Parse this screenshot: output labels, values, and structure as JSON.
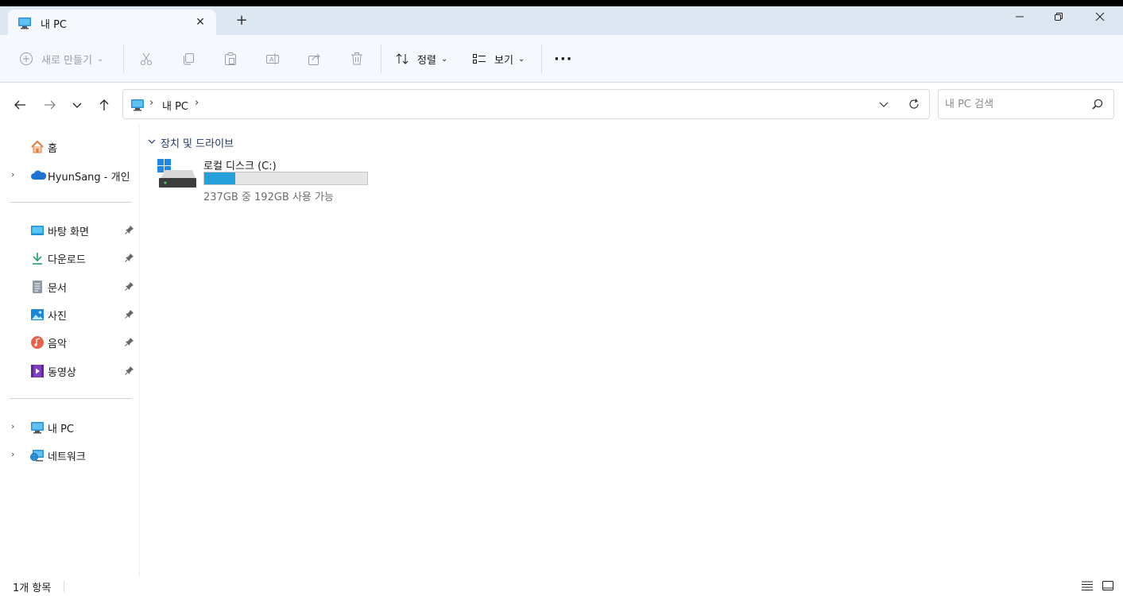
{
  "tab": {
    "title": "내 PC",
    "close_glyph": "✕",
    "new_tab_glyph": "+",
    "icon": "pc-icon"
  },
  "window_controls": {
    "minimize": "—",
    "maximize": "❐",
    "close": "✕"
  },
  "toolbar": {
    "new_label": "새로 만들기",
    "sort_label": "정렬",
    "view_label": "보기",
    "more_label": "···",
    "disabled_color": "#9aa0a6"
  },
  "address": {
    "segment": "내 PC",
    "separator": "›"
  },
  "search": {
    "placeholder": "내 PC 검색"
  },
  "sidebar": {
    "home": {
      "label": "홈",
      "icon": "home-icon"
    },
    "onedrive": {
      "label": "HyunSang - 개인",
      "icon": "cloud-icon"
    },
    "quick": [
      {
        "label": "바탕 화면",
        "icon": "desktop-icon"
      },
      {
        "label": "다운로드",
        "icon": "download-icon"
      },
      {
        "label": "문서",
        "icon": "document-icon"
      },
      {
        "label": "사진",
        "icon": "pictures-icon"
      },
      {
        "label": "음악",
        "icon": "music-icon"
      },
      {
        "label": "동영상",
        "icon": "video-icon"
      }
    ],
    "this_pc": {
      "label": "내 PC",
      "icon": "pc-icon"
    },
    "network": {
      "label": "네트워크",
      "icon": "network-icon"
    }
  },
  "content": {
    "group_title": "장치 및 드라이브",
    "drive": {
      "name": "로컬 디스크 (C:)",
      "space_text": "237GB 중 192GB 사용 가능",
      "used_fraction": 0.19,
      "bar_color": "#26a0da"
    }
  },
  "status": {
    "item_count": "1개 항목"
  }
}
